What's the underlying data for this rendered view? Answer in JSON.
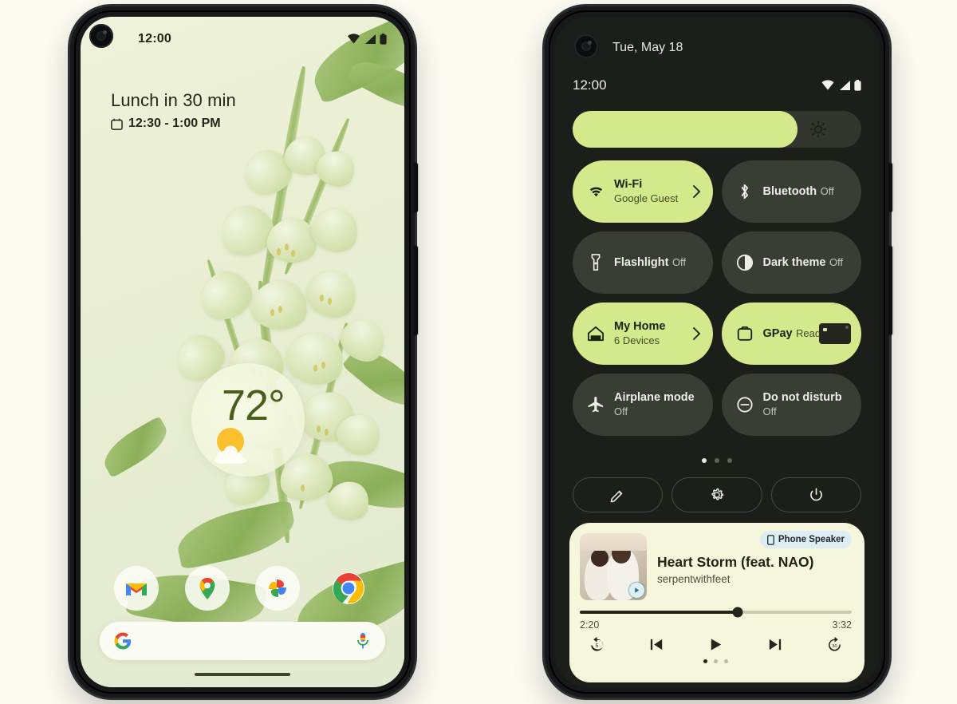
{
  "page": {
    "background_color": "#fbfbf2",
    "accent_green": "#d4e88c",
    "dark_surface": "#1c1e19",
    "tile_surface": "#3a3c36",
    "media_surface": "#f6f6dd"
  },
  "left_phone": {
    "status_bar": {
      "time": "12:00",
      "icons": [
        "wifi-icon",
        "signal-icon",
        "battery-icon"
      ]
    },
    "at_a_glance": {
      "title": "Lunch in 30 min",
      "icon": "calendar-icon",
      "time_range": "12:30 - 1:00 PM"
    },
    "weather_widget": {
      "temperature": "72°",
      "icon": "sun-behind-cloud-icon"
    },
    "dock": [
      {
        "name": "gmail",
        "label": "Gmail"
      },
      {
        "name": "maps",
        "label": "Maps"
      },
      {
        "name": "photos",
        "label": "Photos"
      },
      {
        "name": "chrome",
        "label": "Chrome"
      }
    ],
    "search_bar": {
      "leading_icon": "google-g-icon",
      "trailing_icon": "microphone-icon",
      "placeholder": ""
    }
  },
  "right_phone": {
    "status_bar": {
      "date": "Tue, May 18",
      "time": "12:00",
      "icons": [
        "wifi-icon",
        "signal-icon",
        "battery-icon"
      ]
    },
    "brightness": {
      "icon": "brightness-icon",
      "level_percent": 78
    },
    "tiles": [
      {
        "name": "wifi",
        "label": "Wi-Fi",
        "sub": "Google Guest",
        "state": "on",
        "icon": "wifi-icon",
        "chevron": true
      },
      {
        "name": "bluetooth",
        "label": "Bluetooth",
        "sub": "Off",
        "state": "off",
        "icon": "bluetooth-icon",
        "chevron": false
      },
      {
        "name": "flashlight",
        "label": "Flashlight",
        "sub": "Off",
        "state": "off",
        "icon": "flashlight-icon",
        "chevron": false
      },
      {
        "name": "dark-theme",
        "label": "Dark theme",
        "sub": "Off",
        "state": "off",
        "icon": "contrast-icon",
        "chevron": false
      },
      {
        "name": "my-home",
        "label": "My Home",
        "sub": "6 Devices",
        "state": "on",
        "icon": "home-icon",
        "chevron": true
      },
      {
        "name": "gpay",
        "label": "GPay",
        "sub": "Ready",
        "state": "on",
        "icon": "wallet-icon",
        "chevron": false
      },
      {
        "name": "airplane-mode",
        "label": "Airplane mode",
        "sub": "Off",
        "state": "off",
        "icon": "airplane-icon",
        "chevron": false
      },
      {
        "name": "do-not-disturb",
        "label": "Do not disturb",
        "sub": "Off",
        "state": "off",
        "icon": "do-not-disturb-icon",
        "chevron": false
      }
    ],
    "page_dots": {
      "count": 3,
      "active_index": 0
    },
    "action_buttons": [
      {
        "name": "edit-tiles",
        "icon": "pencil-icon"
      },
      {
        "name": "settings",
        "icon": "gear-icon"
      },
      {
        "name": "power",
        "icon": "power-icon"
      }
    ],
    "media_player": {
      "output_chip": {
        "icon": "phone-icon",
        "label": "Phone Speaker"
      },
      "title": "Heart Storm (feat. NAO)",
      "artist": "serpentwithfeet",
      "album_art_badge_icon": "play-badge-icon",
      "elapsed": "2:20",
      "duration": "3:32",
      "progress_percent": 58,
      "controls": [
        {
          "name": "replay-5",
          "icon": "replay-5-icon"
        },
        {
          "name": "previous",
          "icon": "skip-previous-icon"
        },
        {
          "name": "play",
          "icon": "play-icon"
        },
        {
          "name": "next",
          "icon": "skip-next-icon"
        },
        {
          "name": "forward-30",
          "icon": "forward-30-icon"
        }
      ],
      "page_dots": {
        "count": 3,
        "active_index": 0
      }
    }
  }
}
